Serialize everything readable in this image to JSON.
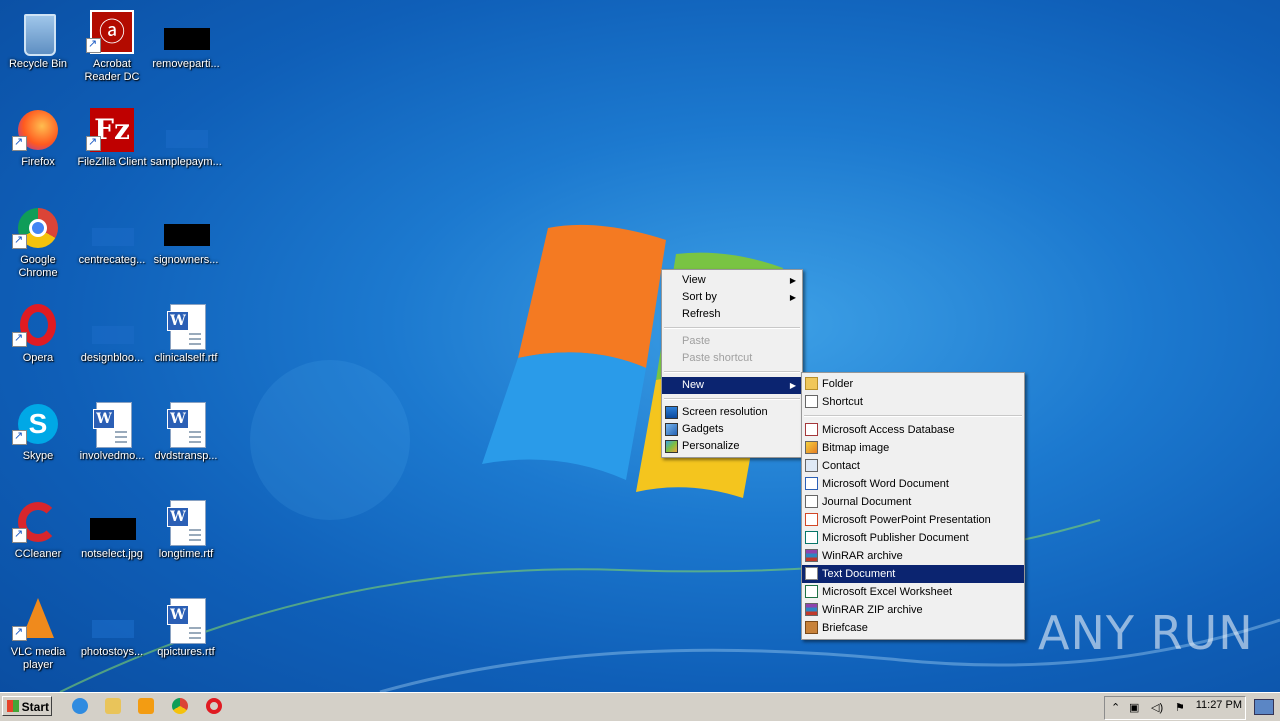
{
  "desktop": {
    "icons": [
      {
        "label": "Recycle Bin"
      },
      {
        "label": "Acrobat Reader DC"
      },
      {
        "label": "removeparti..."
      },
      {
        "label": "Firefox"
      },
      {
        "label": "FileZilla Client"
      },
      {
        "label": "samplepaym..."
      },
      {
        "label": "Google Chrome"
      },
      {
        "label": "centrecateg..."
      },
      {
        "label": "signowners..."
      },
      {
        "label": "Opera"
      },
      {
        "label": "designbloo..."
      },
      {
        "label": "clinicalself.rtf"
      },
      {
        "label": "Skype"
      },
      {
        "label": "involvedmo..."
      },
      {
        "label": "dvdstransp..."
      },
      {
        "label": "CCleaner"
      },
      {
        "label": "notselect.jpg"
      },
      {
        "label": "longtime.rtf"
      },
      {
        "label": "VLC media player"
      },
      {
        "label": "photostoys..."
      },
      {
        "label": "qpictures.rtf"
      }
    ]
  },
  "context_menu": {
    "items": [
      {
        "label": "View",
        "submenu": true
      },
      {
        "label": "Sort by",
        "submenu": true
      },
      {
        "label": "Refresh"
      },
      {
        "label": "Paste",
        "disabled": true
      },
      {
        "label": "Paste shortcut",
        "disabled": true
      },
      {
        "label": "New",
        "submenu": true,
        "highlighted": true
      },
      {
        "label": "Screen resolution"
      },
      {
        "label": "Gadgets"
      },
      {
        "label": "Personalize"
      }
    ]
  },
  "new_submenu": {
    "items": [
      {
        "label": "Folder",
        "icon": "folder-icon"
      },
      {
        "label": "Shortcut",
        "icon": "shortcut-icon"
      },
      {
        "label": "Microsoft Access Database",
        "icon": "access-icon"
      },
      {
        "label": "Bitmap image",
        "icon": "bitmap-icon"
      },
      {
        "label": "Contact",
        "icon": "contact-icon"
      },
      {
        "label": "Microsoft Word Document",
        "icon": "word-icon"
      },
      {
        "label": "Journal Document",
        "icon": "journal-icon"
      },
      {
        "label": "Microsoft PowerPoint Presentation",
        "icon": "powerpoint-icon"
      },
      {
        "label": "Microsoft Publisher Document",
        "icon": "publisher-icon"
      },
      {
        "label": "WinRAR archive",
        "icon": "winrar-icon"
      },
      {
        "label": "Text Document",
        "icon": "text-document-icon",
        "highlighted": true
      },
      {
        "label": "Microsoft Excel Worksheet",
        "icon": "excel-icon"
      },
      {
        "label": "WinRAR ZIP archive",
        "icon": "winrar-zip-icon"
      },
      {
        "label": "Briefcase",
        "icon": "briefcase-icon"
      }
    ]
  },
  "taskbar": {
    "start_label": "Start",
    "clock": "11:27 PM"
  },
  "watermark": "ANY RUN",
  "colors": {
    "menu_highlight": "#0b2470",
    "desktop_blue": "#1c79cf",
    "taskbar": "#d4d0c8"
  }
}
